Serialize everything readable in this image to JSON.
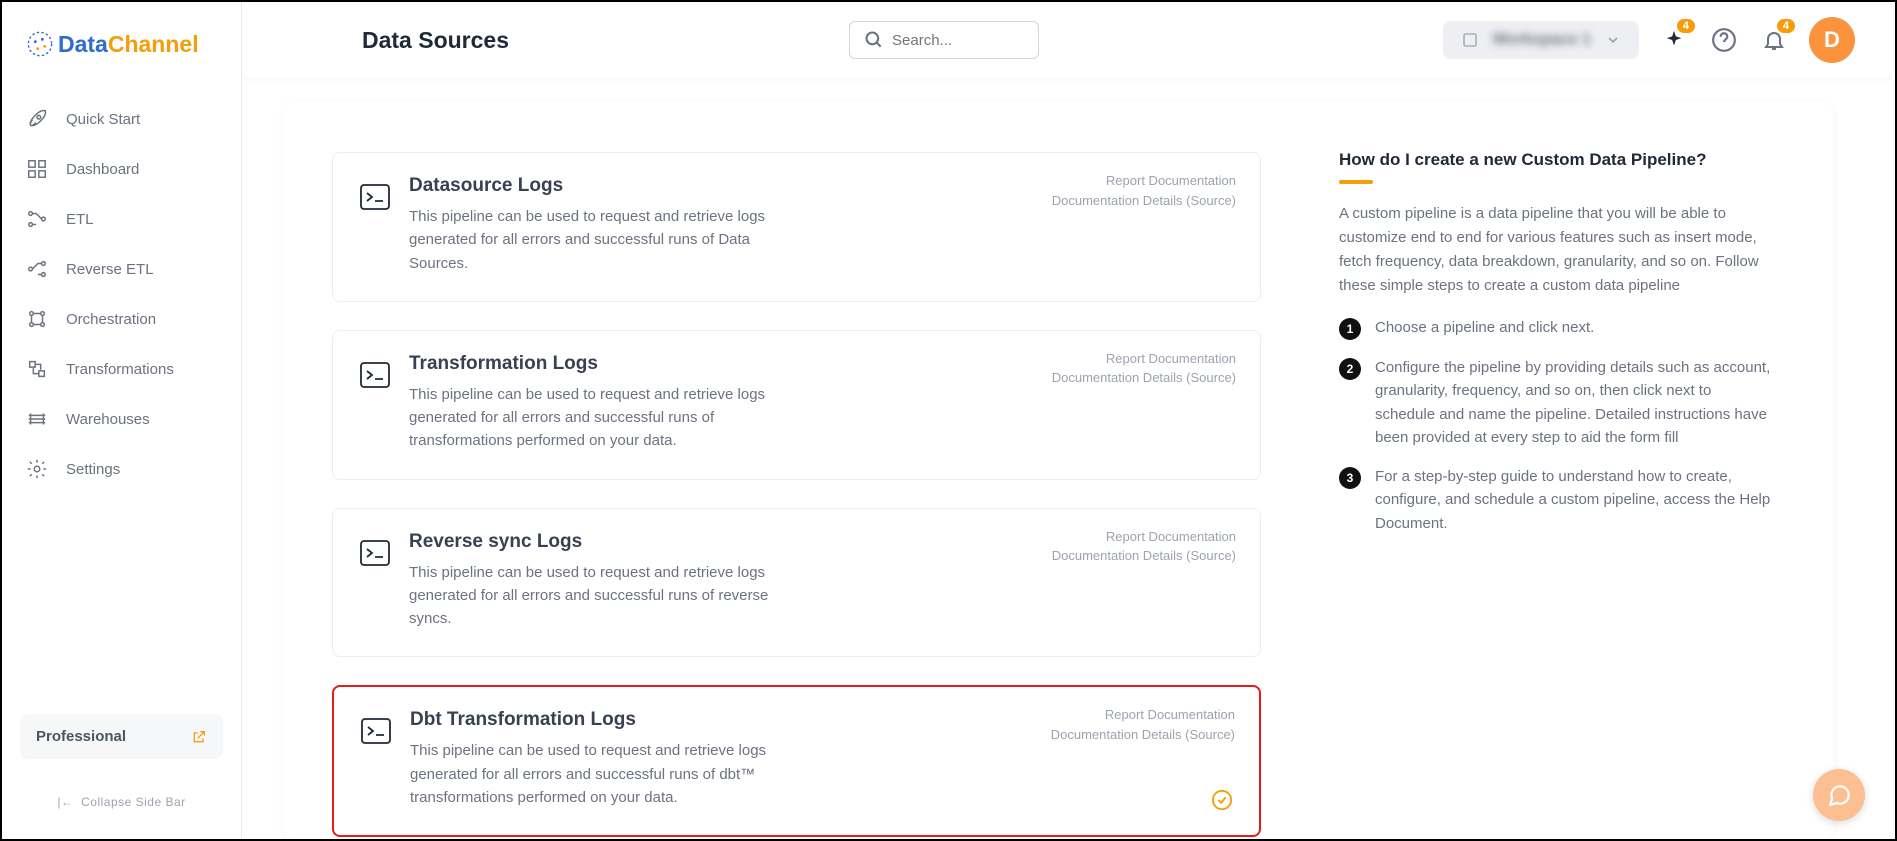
{
  "brand": {
    "name1": "Data",
    "name2": "Channel"
  },
  "sidebar": {
    "items": [
      {
        "label": "Quick Start"
      },
      {
        "label": "Dashboard"
      },
      {
        "label": "ETL"
      },
      {
        "label": "Reverse ETL"
      },
      {
        "label": "Orchestration"
      },
      {
        "label": "Transformations"
      },
      {
        "label": "Warehouses"
      },
      {
        "label": "Settings"
      }
    ],
    "plan": "Professional",
    "collapse": "Collapse Side Bar"
  },
  "header": {
    "title": "Data Sources",
    "search_placeholder": "Search...",
    "workspace": "Workspace 1",
    "badge1": "4",
    "badge2": "4",
    "avatar": "D"
  },
  "cards": [
    {
      "title": "Datasource Logs",
      "desc": "This pipeline can be used to request and retrieve logs generated for all errors and successful runs of Data Sources.",
      "link1": "Report Documentation",
      "link2": "Documentation Details (Source)"
    },
    {
      "title": "Transformation Logs",
      "desc": "This pipeline can be used to request and retrieve logs generated for all errors and successful runs of transformations performed on your data.",
      "link1": "Report Documentation",
      "link2": "Documentation Details (Source)"
    },
    {
      "title": "Reverse sync Logs",
      "desc": "This pipeline can be used to request and retrieve logs generated for all errors and successful runs of reverse syncs.",
      "link1": "Report Documentation",
      "link2": "Documentation Details (Source)"
    },
    {
      "title": "Dbt Transformation Logs",
      "desc": "This pipeline can be used to request and retrieve logs generated for all errors and successful runs of dbt™ transformations performed on your data.",
      "link1": "Report Documentation",
      "link2": "Documentation Details (Source)"
    }
  ],
  "info": {
    "title": "How do I create a new Custom Data Pipeline?",
    "text": "A custom pipeline is a data pipeline that you will be able to customize end to end for various features such as insert mode, fetch frequency, data breakdown, granularity, and so on. Follow these simple steps to create a custom data pipeline",
    "steps": [
      "Choose a pipeline and click next.",
      "Configure the pipeline by providing details such as account, granularity, frequency, and so on, then click next to schedule and name the pipeline. Detailed instructions have been provided at every step to aid the form fill",
      "For a step-by-step guide to understand how to create, configure, and schedule a custom pipeline, access the Help Document."
    ]
  }
}
